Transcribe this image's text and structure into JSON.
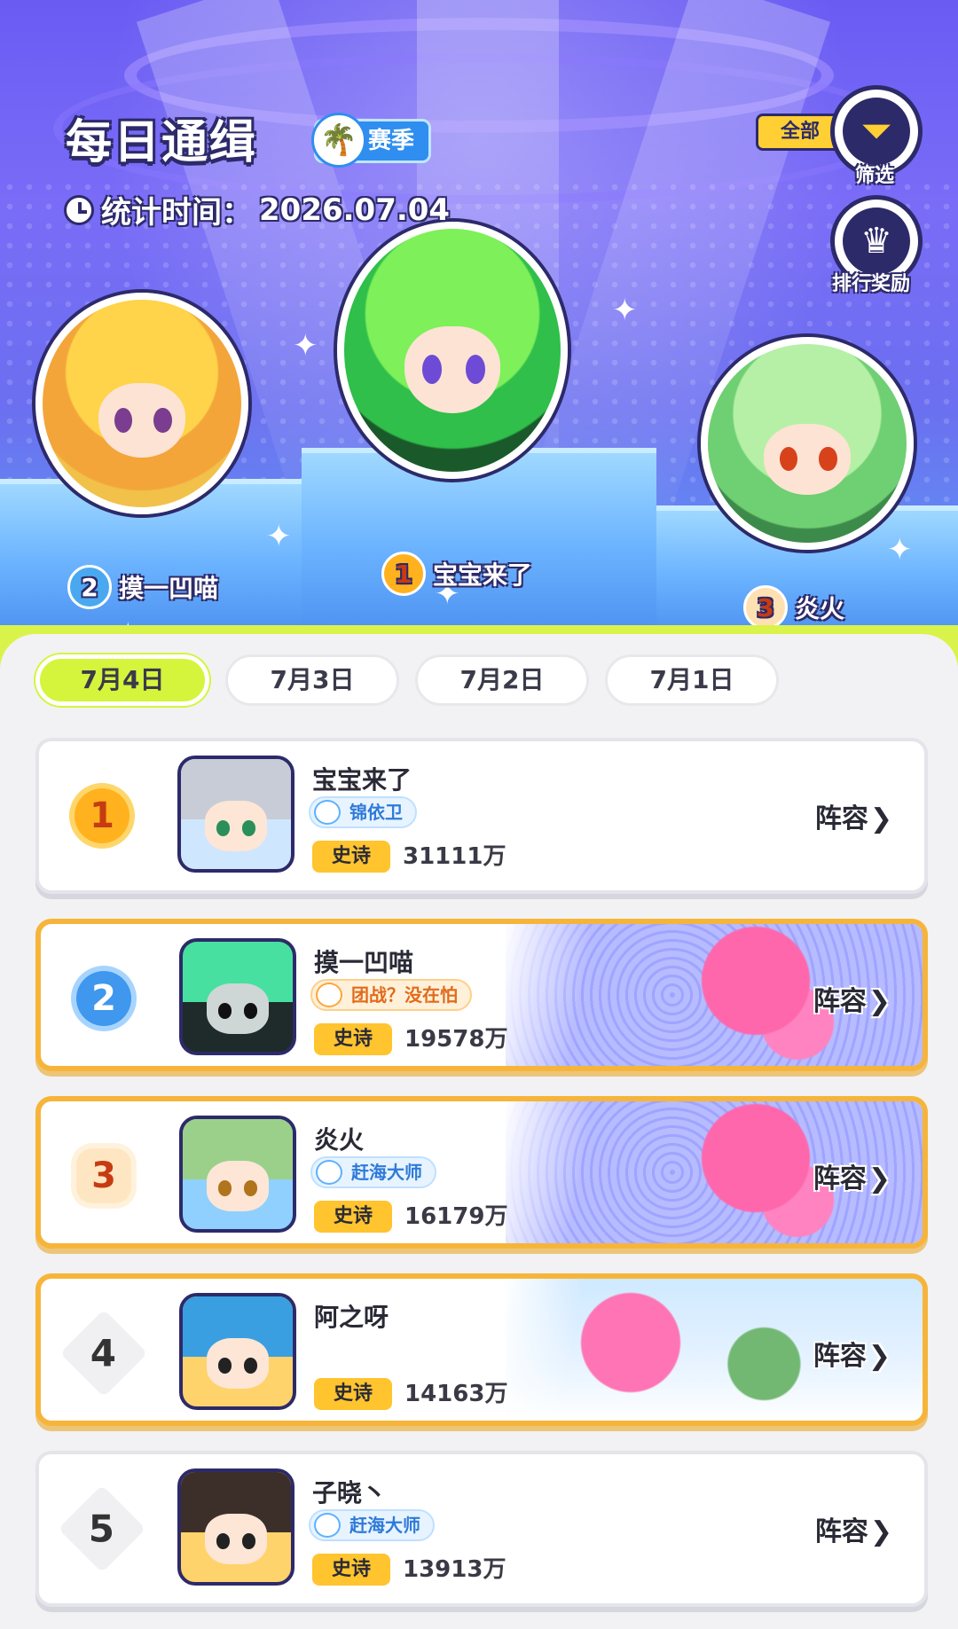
{
  "header": {
    "title": "每日通缉",
    "season_label": "赛季",
    "stat_time_label": "统计时间：",
    "stat_time_value": "2026.07.04",
    "filter_tag": "全部",
    "filter_caption": "筛选",
    "reward_caption": "排行奖励"
  },
  "podium": {
    "first": {
      "rank": "1",
      "name": "宝宝来了"
    },
    "second": {
      "rank": "2",
      "name": "摸一凹喵"
    },
    "third": {
      "rank": "3",
      "name": "炎火"
    }
  },
  "tabs": [
    {
      "label": "7月4日",
      "active": true
    },
    {
      "label": "7月3日",
      "active": false
    },
    {
      "label": "7月2日",
      "active": false
    },
    {
      "label": "7月1日",
      "active": false
    }
  ],
  "rankings": [
    {
      "rank": "1",
      "name": "宝宝来了",
      "title": "锦依卫",
      "tier": "史诗",
      "power": "31111万",
      "lineup": "阵容"
    },
    {
      "rank": "2",
      "name": "摸一凹喵",
      "title": "团战？没在怕",
      "tier": "史诗",
      "power": "19578万",
      "lineup": "阵容"
    },
    {
      "rank": "3",
      "name": "炎火",
      "title": "赶海大师",
      "tier": "史诗",
      "power": "16179万",
      "lineup": "阵容"
    },
    {
      "rank": "4",
      "name": "阿之呀",
      "title": "",
      "tier": "史诗",
      "power": "14163万",
      "lineup": "阵容"
    },
    {
      "rank": "5",
      "name": "子晓丶",
      "title": "赶海大师",
      "tier": "史诗",
      "power": "13913万",
      "lineup": "阵容"
    }
  ],
  "icons": {
    "filter": "filter-icon",
    "rewards": "trophy-icon",
    "clock": "clock-icon",
    "chevron": "chevron-right-icon"
  },
  "colors": {
    "active_tab": "#d4f53c",
    "gold_border": "#f6b53a",
    "tier_badge": "#ffc42e",
    "hero_bg": "#6a5cf3"
  }
}
